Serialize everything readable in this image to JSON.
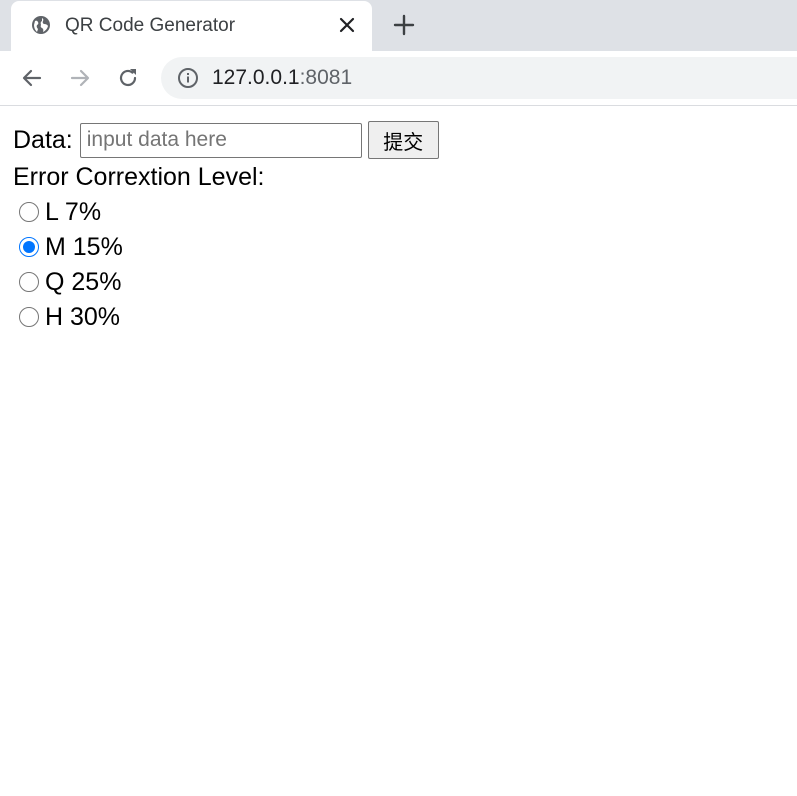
{
  "browser": {
    "tab": {
      "title": "QR Code Generator",
      "favicon": "globe-icon",
      "close_icon": "close-icon"
    },
    "new_tab_icon": "plus-icon",
    "toolbar": {
      "back_icon": "back-arrow-icon",
      "forward_icon": "forward-arrow-icon",
      "reload_icon": "reload-icon",
      "info_icon": "info-icon",
      "url_host": "127.0.0.1",
      "url_port": ":8081"
    }
  },
  "form": {
    "data_label": "Data:",
    "data_value": "",
    "data_placeholder": "input data here",
    "submit_label": "提交",
    "ecl_label": "Error Correxti​on Level:",
    "options": [
      {
        "label": "L 7%",
        "value": "L",
        "checked": false
      },
      {
        "label": "M 15%",
        "value": "M",
        "checked": true
      },
      {
        "label": "Q 25%",
        "value": "Q",
        "checked": false
      },
      {
        "label": "H 30%",
        "value": "H",
        "checked": false
      }
    ]
  },
  "colors": {
    "tabstrip": "#dee1e6",
    "omnibox": "#f1f3f4",
    "radio_accent": "#0075ff"
  }
}
